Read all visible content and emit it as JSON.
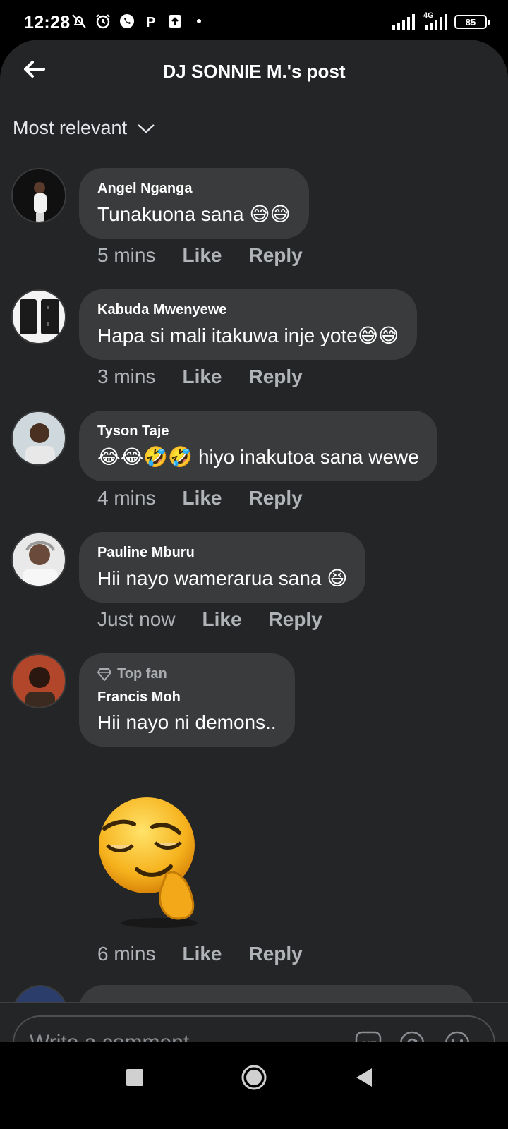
{
  "status": {
    "time": "12:28",
    "network": "4G",
    "battery": "85"
  },
  "header": {
    "title": "DJ SONNIE M.'s post"
  },
  "sort": {
    "label": "Most relevant"
  },
  "actions": {
    "like": "Like",
    "reply": "Reply"
  },
  "comments": [
    {
      "author": "Angel Nganga",
      "text": "Tunakuona sana 😅😅",
      "time": "5 mins"
    },
    {
      "author": "Kabuda Mwenyewe",
      "text": "Hapa si mali itakuwa inje yote😅😅",
      "time": "3 mins"
    },
    {
      "author": "Tyson Taje",
      "text": "😂😂🤣🤣 hiyo inakutoa sana wewe",
      "time": "4 mins"
    },
    {
      "author": "Pauline Mburu",
      "text": "Hii nayo wamerarua sana 😆",
      "time": "Just now"
    },
    {
      "badge": "Top fan",
      "author": "Francis Moh",
      "text": "Hii nayo ni demons..",
      "time": "6 mins"
    }
  ],
  "composer": {
    "placeholder": "Write a comment…",
    "gif": "GIF"
  },
  "colors": {
    "panel": "#242526",
    "bubble": "#3a3b3c",
    "muted": "#b0b3b8"
  }
}
